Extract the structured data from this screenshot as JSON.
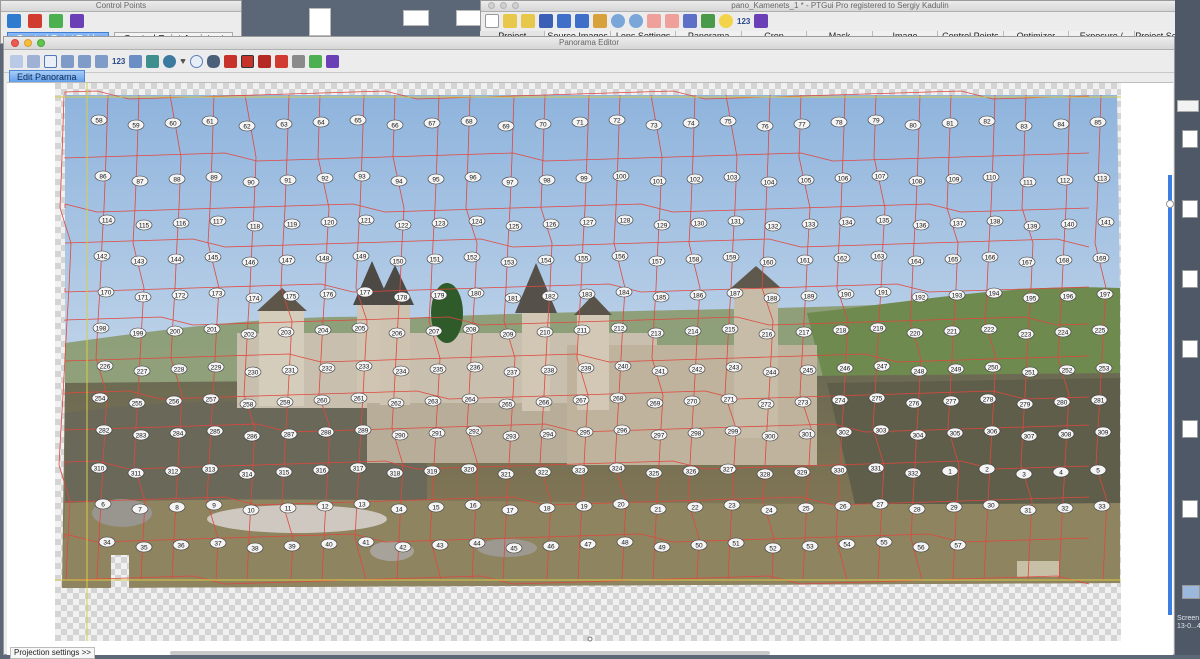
{
  "control_points_window": {
    "title": "Control Points",
    "tabs": [
      "Control Point Table",
      "Control Point Assistant"
    ],
    "active_tab": "Control Point Table",
    "toolbar_icons": [
      "pin-icon",
      "delete-icon",
      "window-icon",
      "book-icon"
    ]
  },
  "main_window": {
    "title": "pano_Kamenets_1 * - PTGui Pro registered to Sergiy Kadulin",
    "toolbar_icons": [
      "new-icon",
      "open-icon",
      "save-icon",
      "undo-icon",
      "redo-icon",
      "cut-icon",
      "zoom-in-icon",
      "zoom-out-icon",
      "prev-icon",
      "next-icon",
      "panorama-icon",
      "table-icon",
      "bulb-icon",
      "book-icon"
    ],
    "toolbar_number": "123",
    "tabs": [
      "Project Assistant",
      "Source Images",
      "Lens Settings",
      "Panorama Settings",
      "Crop",
      "Mask",
      "Image Parameters",
      "Control Points",
      "Optimizer",
      "Exposure / HDR",
      "Project Settings"
    ]
  },
  "panorama_editor": {
    "title": "Panorama Editor",
    "toolbar_number": "123",
    "toolbar_icons": [
      "select-icon",
      "hand-icon",
      "frame-icon",
      "move-icon",
      "numbers-icon",
      "image-icon",
      "layers-icon",
      "globe-icon",
      "dropdown-icon",
      "zoom-icon",
      "eye-icon",
      "red-square-icon",
      "red-square-icon",
      "red-square-icon",
      "red-square-icon",
      "gray-square-icon",
      "window-icon",
      "book-icon"
    ],
    "edit_tab": "Edit Panorama",
    "projection_button": "Projection settings >>",
    "control_point_labels": [
      "58",
      "59",
      "60",
      "61",
      "62",
      "63",
      "64",
      "65",
      "66",
      "67",
      "68",
      "69",
      "70",
      "71",
      "72",
      "73",
      "74",
      "75",
      "76",
      "77",
      "78",
      "79",
      "80",
      "81",
      "82",
      "83",
      "84",
      "85",
      "86",
      "87",
      "88",
      "89",
      "90",
      "91",
      "92",
      "93",
      "94",
      "95",
      "96",
      "97",
      "98",
      "99",
      "100",
      "101",
      "102",
      "103",
      "104",
      "105",
      "106",
      "107",
      "108",
      "109",
      "110",
      "111",
      "112",
      "113",
      "114",
      "115",
      "116",
      "117",
      "118",
      "119",
      "120",
      "121",
      "122",
      "123",
      "124",
      "125",
      "126",
      "127",
      "128",
      "129",
      "130",
      "131",
      "132",
      "133",
      "134",
      "135",
      "136",
      "137",
      "138",
      "139",
      "140",
      "141",
      "142",
      "143",
      "144",
      "145",
      "146",
      "147",
      "148",
      "149",
      "150",
      "151",
      "152",
      "153",
      "154",
      "155",
      "156",
      "157",
      "158",
      "159",
      "160",
      "161",
      "162",
      "163",
      "164",
      "165",
      "166",
      "167",
      "168",
      "169",
      "170",
      "171",
      "172",
      "173",
      "174",
      "175",
      "176",
      "177",
      "178",
      "179",
      "180",
      "181",
      "182",
      "183",
      "184",
      "185",
      "186",
      "187",
      "188",
      "189",
      "190",
      "191",
      "192",
      "193",
      "194",
      "195",
      "196",
      "197",
      "198",
      "199",
      "200",
      "201",
      "202",
      "203",
      "204",
      "205",
      "206",
      "207",
      "208",
      "209",
      "210",
      "211",
      "212",
      "213",
      "214",
      "215",
      "216",
      "217",
      "218",
      "219",
      "220",
      "221",
      "222",
      "223",
      "224",
      "225",
      "226",
      "227",
      "228",
      "229",
      "230",
      "231",
      "232",
      "233",
      "234",
      "235",
      "236",
      "237",
      "238",
      "239",
      "240",
      "241",
      "242",
      "243",
      "244",
      "245",
      "246",
      "247",
      "248",
      "249",
      "250",
      "251",
      "252",
      "253",
      "254",
      "255",
      "256",
      "257",
      "258",
      "259",
      "260",
      "261",
      "262",
      "263",
      "264",
      "265",
      "266",
      "267",
      "268",
      "269",
      "270",
      "271",
      "272",
      "273",
      "274",
      "275",
      "276",
      "277",
      "278",
      "279",
      "280",
      "281",
      "282",
      "283",
      "284",
      "285",
      "286",
      "287",
      "288",
      "289",
      "290",
      "291",
      "292",
      "293",
      "294",
      "295",
      "296",
      "297",
      "298",
      "299",
      "300",
      "301",
      "302",
      "303",
      "304",
      "305",
      "306",
      "307",
      "308",
      "309",
      "310",
      "311",
      "312",
      "313",
      "314",
      "315",
      "316",
      "317",
      "318",
      "319",
      "320",
      "321",
      "322",
      "323",
      "324",
      "325",
      "326",
      "327",
      "328",
      "329",
      "330",
      "331",
      "332",
      "1",
      "2",
      "3",
      "4",
      "5",
      "6",
      "7",
      "8",
      "9",
      "10",
      "11",
      "12",
      "13",
      "14",
      "15",
      "16",
      "17",
      "18",
      "19",
      "20",
      "21",
      "22",
      "23",
      "24",
      "25",
      "26",
      "27",
      "28",
      "29",
      "30",
      "31",
      "32",
      "33",
      "34",
      "35",
      "36",
      "37",
      "38",
      "39",
      "40",
      "41",
      "42",
      "43",
      "44",
      "45",
      "46",
      "47",
      "48",
      "49",
      "50",
      "51",
      "52",
      "53",
      "54",
      "55",
      "56",
      "57"
    ]
  },
  "right_strip": {
    "label": "Screen 5\n13-0...4",
    "colors": {
      "accent": "#3b7de0",
      "cell_line": "#e0473e"
    }
  }
}
